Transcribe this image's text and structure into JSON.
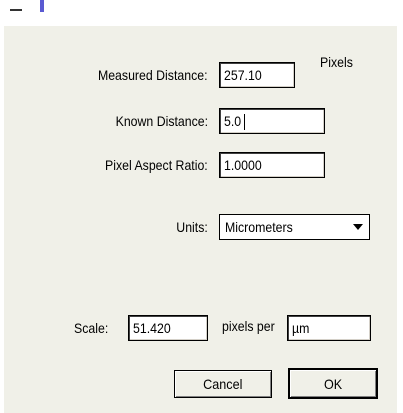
{
  "dialog": {
    "measured_distance": {
      "label": "Measured Distance:",
      "value": "257.10",
      "unit": "Pixels"
    },
    "known_distance": {
      "label": "Known Distance:",
      "value": "5.0"
    },
    "pixel_aspect_ratio": {
      "label": "Pixel Aspect Ratio:",
      "value": "1.0000"
    },
    "units": {
      "label": "Units:",
      "selected": "Micrometers"
    },
    "scale": {
      "label": "Scale:",
      "value": "51.420",
      "per_label": "pixels per",
      "unit_value": "µm"
    },
    "buttons": {
      "cancel": "Cancel",
      "ok": "OK"
    }
  }
}
